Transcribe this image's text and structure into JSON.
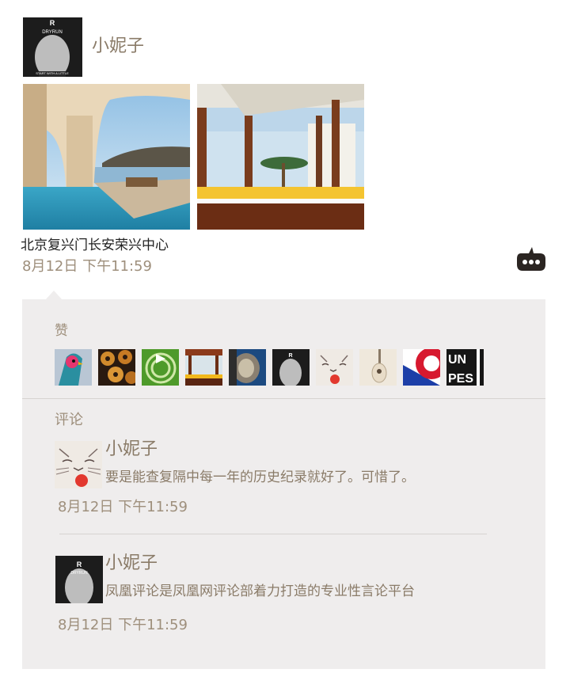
{
  "post": {
    "author": "小妮子",
    "author_avatar_logo": "DRYRUN",
    "author_avatar_slogan": "START WITH A LITTLE",
    "location": "北京复兴门长安荣兴中心",
    "time": "8月12日  下午11:59"
  },
  "likes": {
    "label": "赞",
    "avatars": [
      "bird-avatar",
      "donut-avatar",
      "green-swirl-avatar",
      "resort-avatar",
      "coin-avatar",
      "dryrun-avatar",
      "cat-avatar",
      "guitar-avatar",
      "flag-avatar",
      "text-avatar"
    ],
    "text_avatar_text": "UN PES"
  },
  "comments": {
    "label": "评论",
    "items": [
      {
        "author": "小妮子",
        "text": "要是能查复隔中每一年的历史纪录就好了。可惜了。",
        "time": "8月12日  下午11:59",
        "avatar": "cat-avatar"
      },
      {
        "author": "小妮子",
        "text": "凤凰评论是凤凰网评论部着力打造的专业性言论平台",
        "time": "8月12日  下午11:59",
        "avatar": "dryrun-avatar"
      }
    ]
  }
}
